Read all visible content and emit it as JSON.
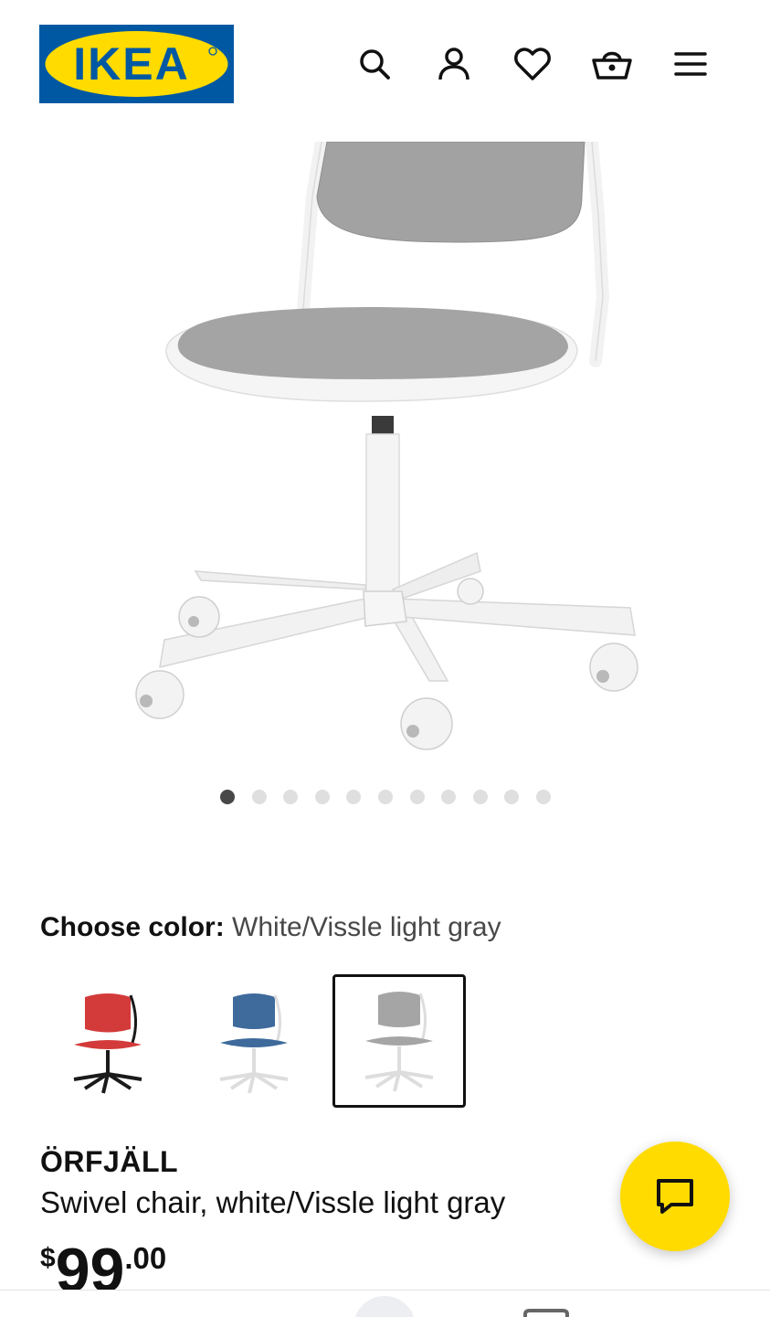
{
  "header": {
    "logo_text": "IKEA",
    "brand_colors": {
      "blue": "#0058a3",
      "yellow": "#ffdb00"
    },
    "icons": [
      "search-icon",
      "account-icon",
      "heart-icon",
      "cart-icon",
      "menu-icon"
    ]
  },
  "gallery": {
    "image_count": 11,
    "active_index": 0
  },
  "color_chooser": {
    "label": "Choose color:",
    "value": "White/Vissle light gray",
    "options": [
      {
        "seat_color": "#d33a3a",
        "frame_color": "#1a1a1a"
      },
      {
        "seat_color": "#3e6a9c",
        "frame_color": "#f3f3f3"
      },
      {
        "seat_color": "#a5a5a5",
        "frame_color": "#f3f3f3",
        "selected": true
      }
    ]
  },
  "product": {
    "name": "ÖRFJÄLL",
    "description": "Swivel chair, white/Vissle light gray",
    "price": {
      "currency": "$",
      "integer": "99",
      "decimal": ".00"
    }
  },
  "chat": {
    "icon": "chat-icon",
    "color": "#ffdb00"
  }
}
